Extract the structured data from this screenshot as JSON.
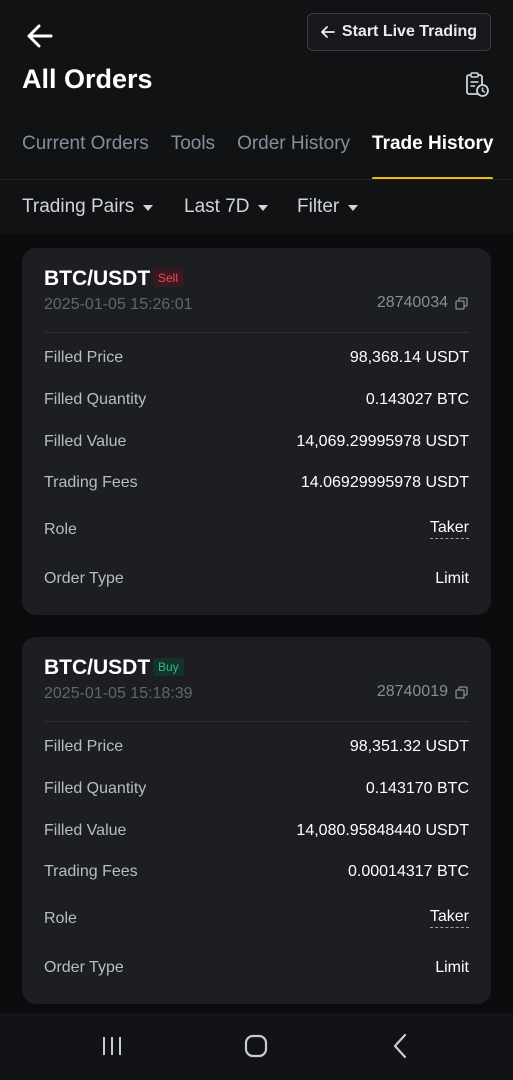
{
  "header": {
    "live_label": "Start Live Trading",
    "title": "All Orders",
    "tabs": [
      "Current Orders",
      "Tools",
      "Order History",
      "Trade History"
    ],
    "active_tab": "Trade History"
  },
  "filters": [
    {
      "label": "Trading Pairs"
    },
    {
      "label": "Last 7D"
    },
    {
      "label": "Filter"
    }
  ],
  "labels": {
    "filled_price": "Filled Price",
    "filled_quantity": "Filled Quantity",
    "filled_value": "Filled Value",
    "trading_fees": "Trading Fees",
    "role": "Role",
    "order_type": "Order Type"
  },
  "orders": [
    {
      "pair": "BTC/USDT",
      "side": "Sell",
      "time": "2025-01-05 15:26:01",
      "order_id": "28740034",
      "filled_price": "98,368.14 USDT",
      "filled_quantity": "0.143027 BTC",
      "filled_value": "14,069.29995978 USDT",
      "trading_fees": "14.06929995978 USDT",
      "role": "Taker",
      "order_type": "Limit"
    },
    {
      "pair": "BTC/USDT",
      "side": "Buy",
      "time": "2025-01-05 15:18:39",
      "order_id": "28740019",
      "filled_price": "98,351.32 USDT",
      "filled_quantity": "0.143170 BTC",
      "filled_value": "14,080.95848440 USDT",
      "trading_fees": "0.00014317 BTC",
      "role": "Taker",
      "order_type": "Limit"
    }
  ],
  "colors": {
    "accent": "#f0b90b",
    "sell": "#f6465d",
    "buy": "#2ebd85"
  },
  "icons": {
    "back": "arrow-left-icon",
    "history": "order-history-icon",
    "copy": "copy-icon"
  }
}
